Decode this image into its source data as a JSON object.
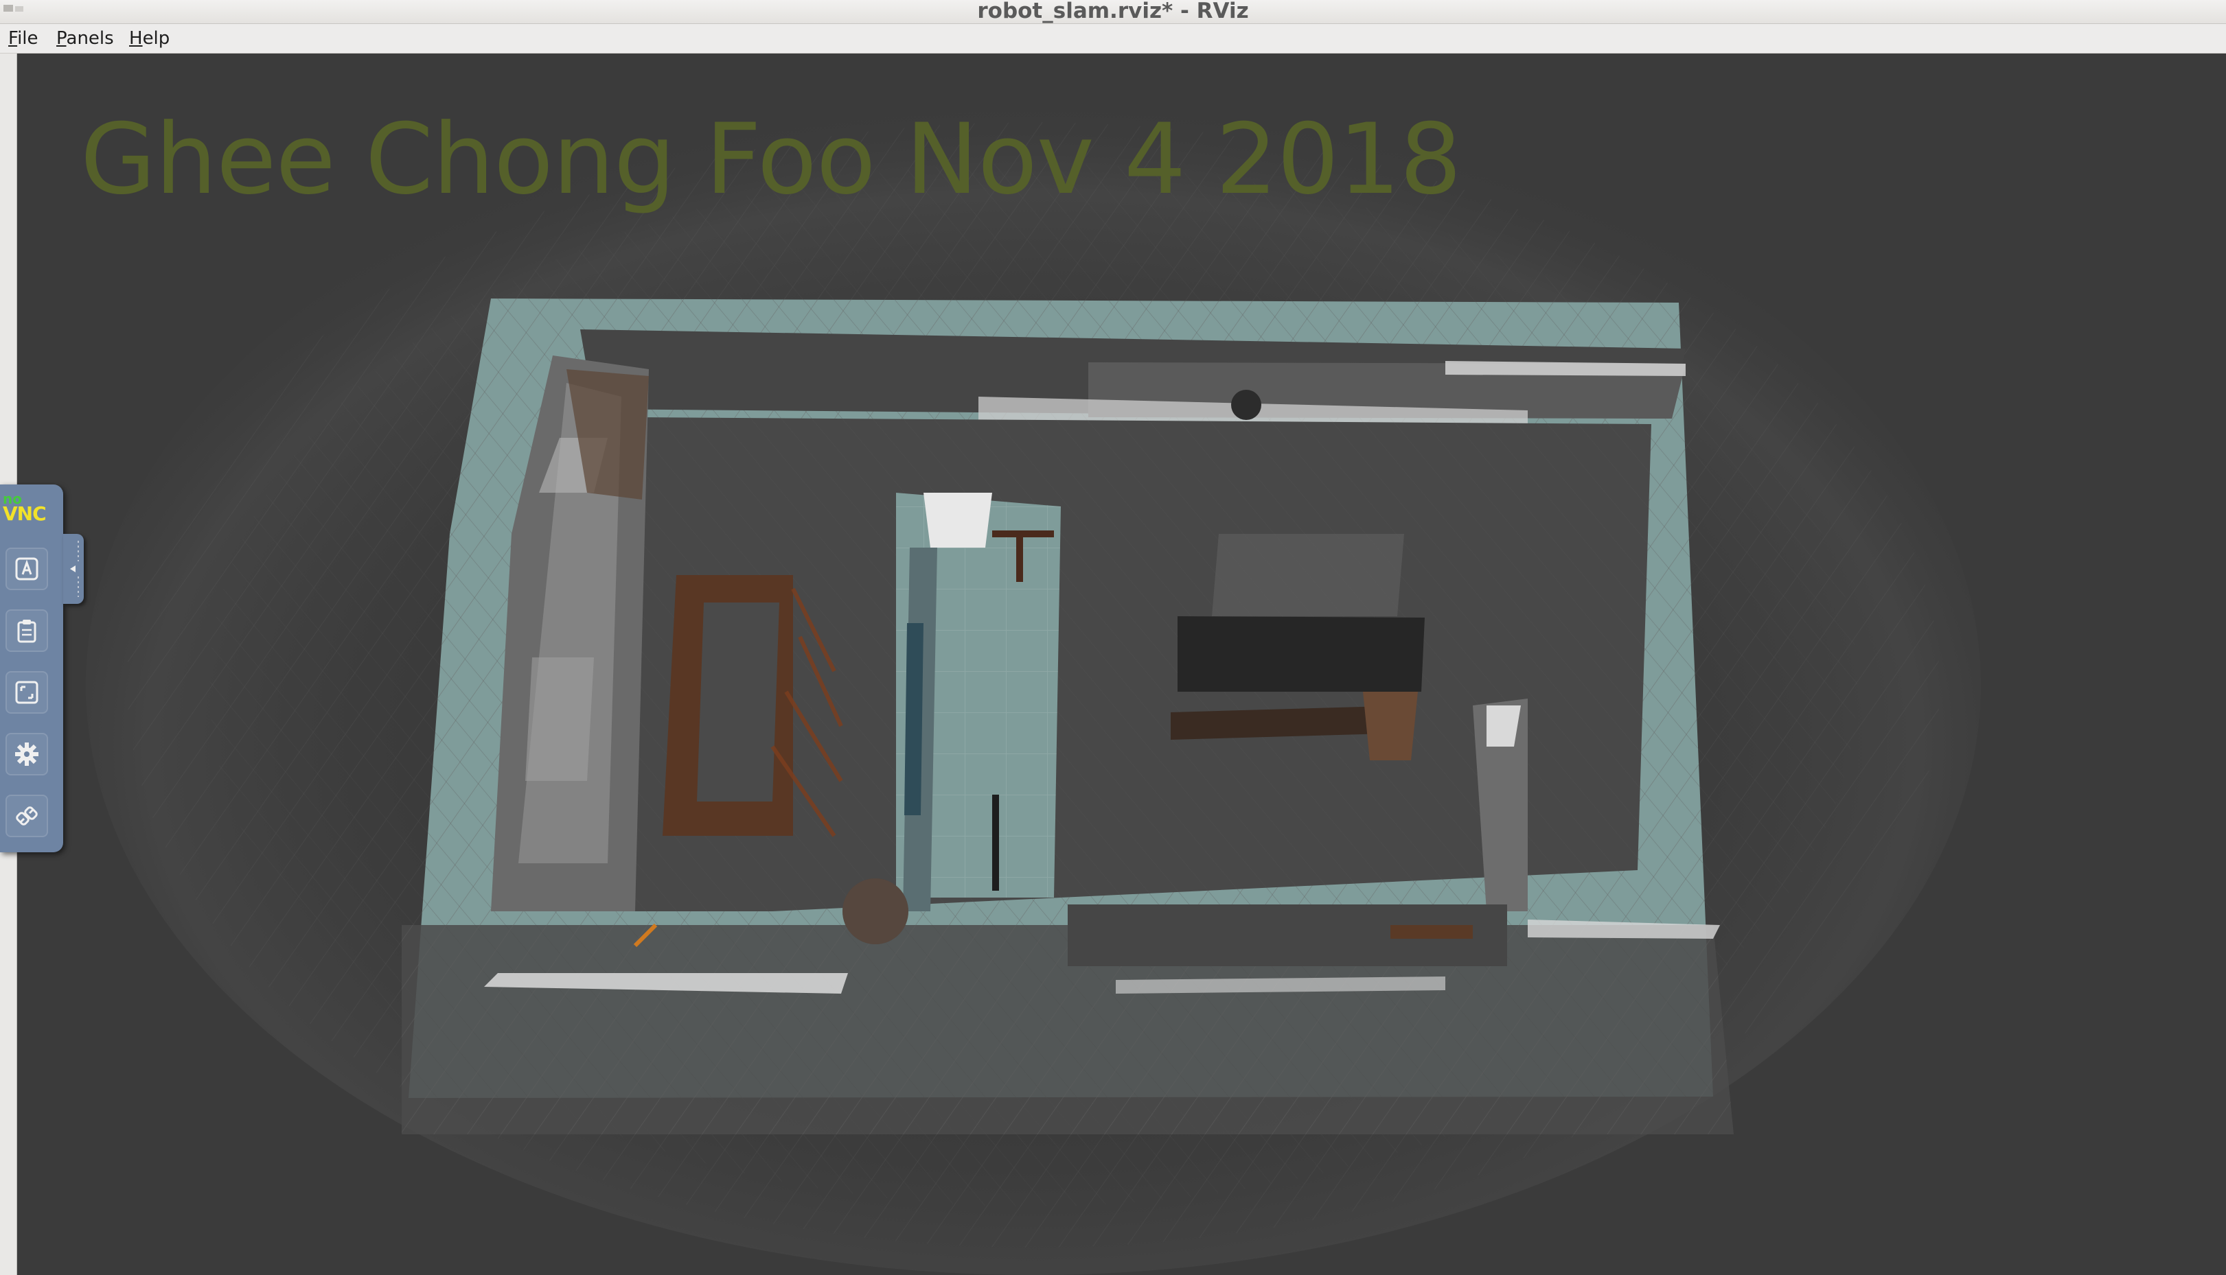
{
  "window": {
    "title": "robot_slam.rviz* - RViz"
  },
  "menubar": {
    "items": [
      {
        "label_first": "F",
        "label_rest": "ile"
      },
      {
        "label_first": "P",
        "label_rest": "anels"
      },
      {
        "label_first": "H",
        "label_rest": "elp"
      }
    ]
  },
  "viewport": {
    "overlay_text": "Ghee Chong Foo Nov 4 2018",
    "overlay_color": "#55602a",
    "background_color": "#3b3b3b",
    "floor_color": "#7f9c9a",
    "wall_color": "#4a4a4a"
  },
  "novnc": {
    "logo_top": "no",
    "logo_bottom": "VNC",
    "buttons": [
      {
        "icon": "keyboard-a-icon"
      },
      {
        "icon": "clipboard-icon"
      },
      {
        "icon": "fullscreen-icon"
      },
      {
        "icon": "gear-icon"
      },
      {
        "icon": "disconnect-icon"
      }
    ]
  }
}
